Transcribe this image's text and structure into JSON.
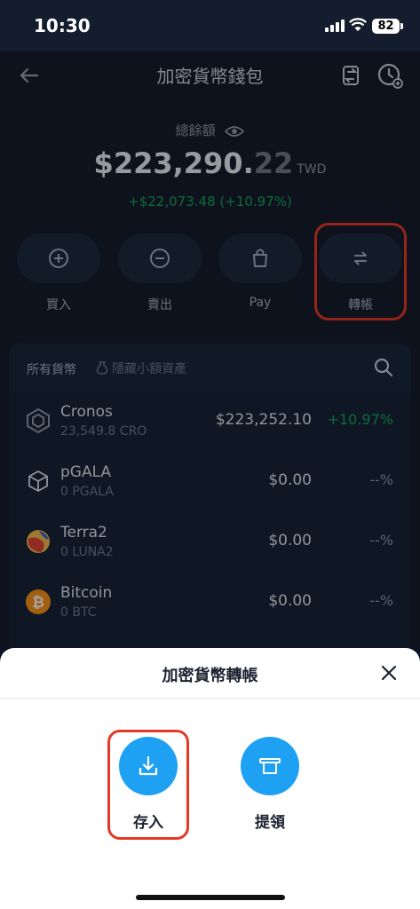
{
  "status_bar": {
    "time": "10:30",
    "battery": "82"
  },
  "header": {
    "title": "加密貨幣錢包"
  },
  "balance": {
    "label": "總餘額",
    "amount_main": "$223,290.",
    "amount_cents": "22",
    "currency": "TWD",
    "change": "+$22,073.48 (+10.97%)"
  },
  "actions": [
    {
      "label": "買入",
      "icon": "plus-circle-icon"
    },
    {
      "label": "賣出",
      "icon": "minus-circle-icon"
    },
    {
      "label": "Pay",
      "icon": "shopping-bag-icon"
    },
    {
      "label": "轉帳",
      "icon": "transfer-arrows-icon"
    }
  ],
  "coin_list": {
    "title": "所有貨幣",
    "hide_small": "隱藏小額資產",
    "coins": [
      {
        "name": "Cronos",
        "amount": "23,549.8 CRO",
        "value": "$223,252.10",
        "change": "+10.97%",
        "color": "#8e98a8"
      },
      {
        "name": "pGALA",
        "amount": "0 PGALA",
        "value": "$0.00",
        "change": "--%",
        "color": "#e8ecf2"
      },
      {
        "name": "Terra2",
        "amount": "0 LUNA2",
        "value": "$0.00",
        "change": "--%",
        "color": "#f0b84a"
      },
      {
        "name": "Bitcoin",
        "amount": "0 BTC",
        "value": "$0.00",
        "change": "--%",
        "color": "#f7931a"
      }
    ]
  },
  "sheet": {
    "title": "加密貨幣轉帳",
    "deposit_label": "存入",
    "withdraw_label": "提領",
    "accent": "#1ea1f2"
  },
  "colors": {
    "positive": "#17a45c",
    "highlight": "#e33a25"
  }
}
